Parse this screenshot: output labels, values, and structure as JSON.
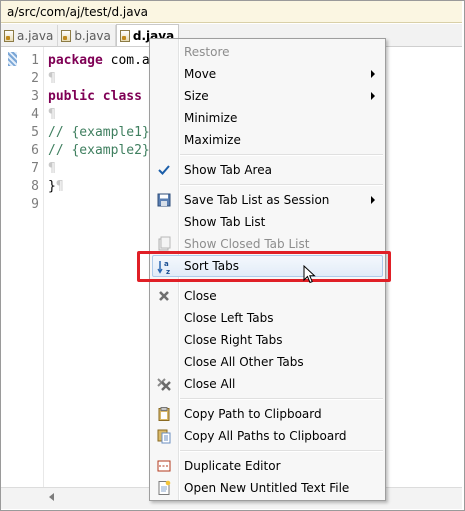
{
  "path_bar": {
    "text": "a/src/com/aj/test/d.java"
  },
  "tabs": [
    {
      "label": "a.java",
      "active": false
    },
    {
      "label": "b.java",
      "active": false
    },
    {
      "label": "d.java",
      "active": true
    }
  ],
  "editor": {
    "line_numbers": [
      "1",
      "2",
      "3",
      "4",
      "5",
      "6",
      "7",
      "8",
      "9"
    ],
    "lines": {
      "l1_kw": "package",
      "l1_rest": " com.a",
      "l3_kw1": "public",
      "l3_kw2": "class",
      "l5": "// {example1}",
      "l6": "// {example2}",
      "l8": "}",
      "pilcrow": "¶"
    }
  },
  "context_menu": {
    "items": {
      "restore": "Restore",
      "move": "Move",
      "size": "Size",
      "minimize": "Minimize",
      "maximize": "Maximize",
      "show_tab_area": "Show Tab Area",
      "save_tab_list": "Save Tab List as Session",
      "show_tab_list": "Show Tab List",
      "show_closed_tab_list": "Show Closed Tab List",
      "sort_tabs": "Sort Tabs",
      "close": "Close",
      "close_left_tabs": "Close Left Tabs",
      "close_right_tabs": "Close Right Tabs",
      "close_all_other_tabs": "Close All Other Tabs",
      "close_all": "Close All",
      "copy_path": "Copy Path to Clipboard",
      "copy_all_paths": "Copy All Paths to Clipboard",
      "duplicate_editor": "Duplicate Editor",
      "open_new_untitled": "Open New Untitled Text File"
    },
    "icons": {
      "show_tab_area": "checkmark-icon",
      "save_tab_list": "save-icon",
      "show_closed_tab_list": "closed-tabs-icon",
      "sort_tabs": "sort-az-icon",
      "close": "close-x-icon",
      "close_all": "close-all-icon",
      "copy_path": "clipboard-icon",
      "copy_all_paths": "clipboard-multi-icon",
      "duplicate_editor": "duplicate-icon",
      "open_new_untitled": "new-file-icon"
    }
  },
  "colors": {
    "highlight_border": "#e01f26",
    "keyword": "#7f0055",
    "comment": "#3f7f5f"
  }
}
